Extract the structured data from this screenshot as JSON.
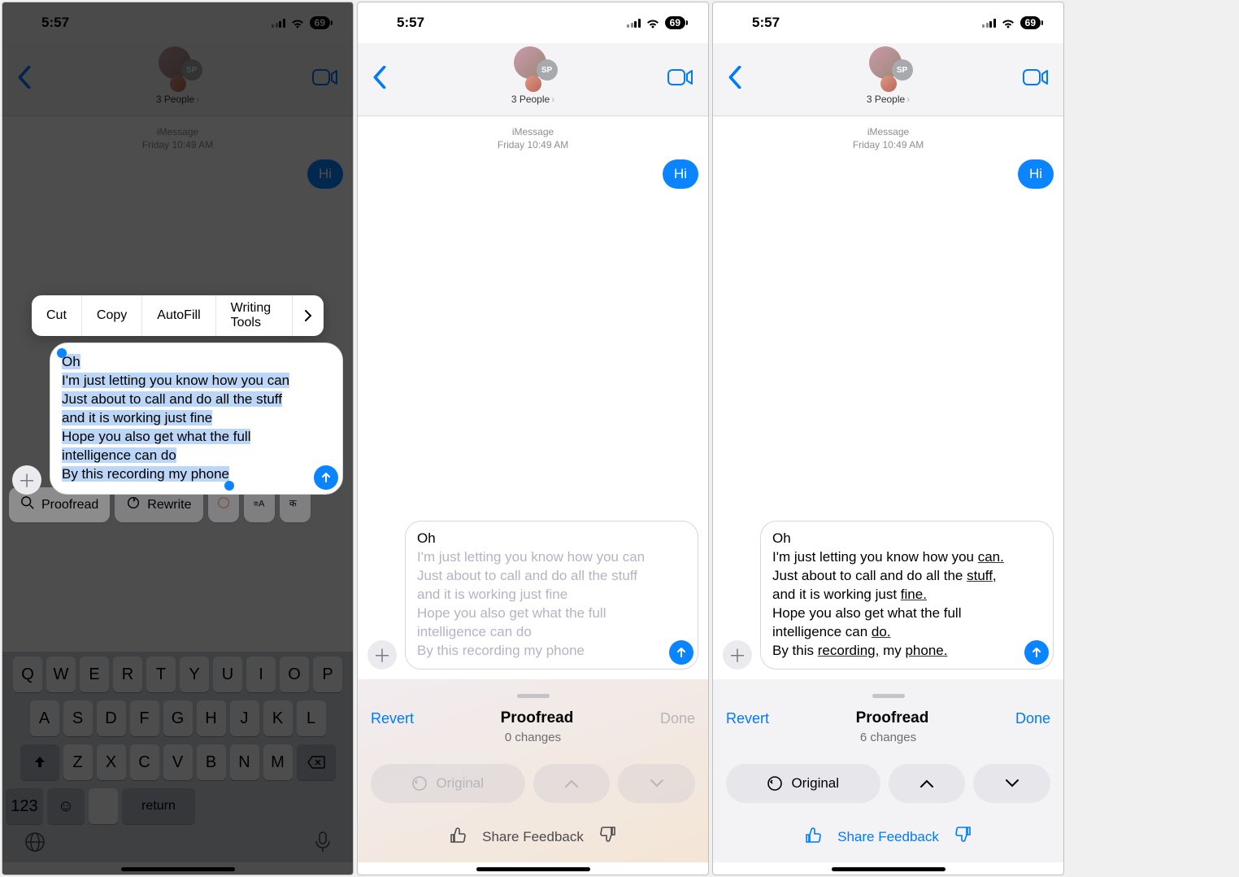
{
  "status": {
    "time": "5:57",
    "battery": "69"
  },
  "nav": {
    "group_label": "3 People",
    "avatar_badge": "SP"
  },
  "conv": {
    "service": "iMessage",
    "timestamp": "Friday 10:49 AM",
    "incoming_hi": "Hi"
  },
  "compose_lines": {
    "l1": "Oh",
    "l2": "I'm just letting you know how you can",
    "l3": "Just about to call and do all the stuff",
    "l4": "and it is working just fine",
    "l5": "Hope you also get what the full",
    "l6": "intelligence can do",
    "l7": "By this recording my phone"
  },
  "s3_compose": {
    "l1": "Oh",
    "l2a": "I'm just letting you know how you ",
    "l2u": "can.",
    "l3a": "Just about to call and do all the ",
    "l3u": "stuff,",
    "l4a": "and it is working just ",
    "l4u": "fine.",
    "l5": "Hope you also get what the full",
    "l6a": "intelligence can ",
    "l6u": "do.",
    "l7a": "By this ",
    "l7u1": "recording,",
    "l7b": " my ",
    "l7u2": "phone."
  },
  "edit_menu": {
    "cut": "Cut",
    "copy": "Copy",
    "autofill": "AutoFill",
    "writing_tools": "Writing Tools"
  },
  "wt_row": {
    "proofread": "Proofread",
    "rewrite": "Rewrite"
  },
  "keyboard": {
    "r1": [
      "Q",
      "W",
      "E",
      "R",
      "T",
      "Y",
      "U",
      "I",
      "O",
      "P"
    ],
    "r2": [
      "A",
      "S",
      "D",
      "F",
      "G",
      "H",
      "J",
      "K",
      "L"
    ],
    "r3": [
      "Z",
      "X",
      "C",
      "V",
      "B",
      "N",
      "M"
    ],
    "num": "123",
    "space": " ",
    "ret": "return"
  },
  "proofread": {
    "revert": "Revert",
    "title": "Proofread",
    "done": "Done",
    "changes0": "0 changes",
    "changes6": "6 changes",
    "original": "Original",
    "share": "Share Feedback"
  }
}
